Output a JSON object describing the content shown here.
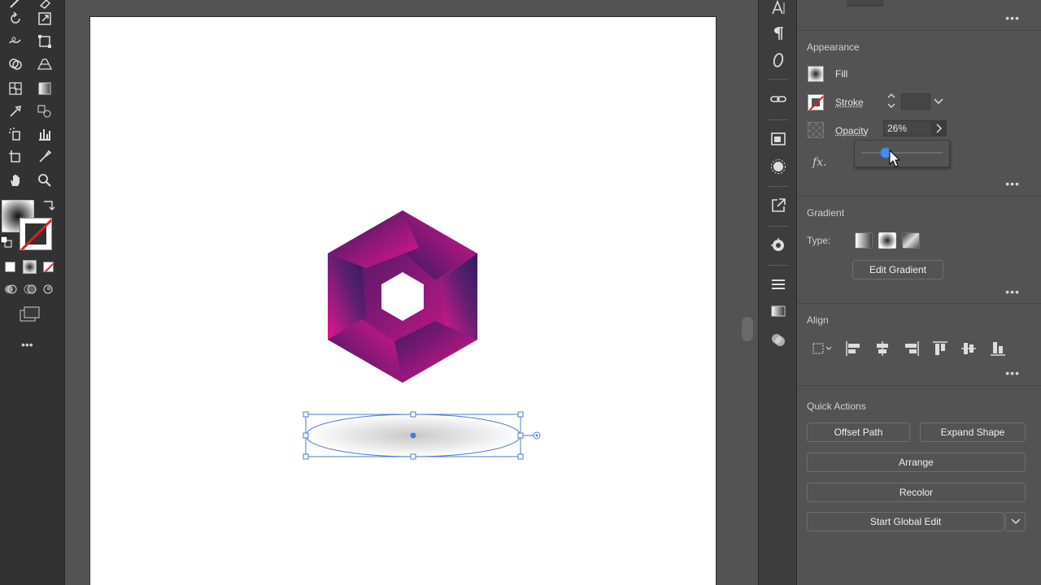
{
  "appearance": {
    "title": "Appearance",
    "fill_label": "Fill",
    "stroke_label": "Stroke",
    "opacity_label": "Opacity",
    "opacity_value": "26%",
    "opacity_fraction": 0.26,
    "fx_label": "fx.",
    "more": "•••"
  },
  "gradient": {
    "title": "Gradient",
    "type_label": "Type:",
    "edit_button": "Edit Gradient",
    "more": "•••"
  },
  "align": {
    "title": "Align",
    "more": "•••"
  },
  "quick_actions": {
    "title": "Quick Actions",
    "offset_path": "Offset Path",
    "expand_shape": "Expand Shape",
    "arrange": "Arrange",
    "recolor": "Recolor",
    "start_global_edit": "Start Global Edit"
  },
  "toolbar": {
    "more": "•••"
  },
  "colors": {
    "hex_pink": "#e8168f",
    "hex_navy": "#2b1a5e",
    "selection_blue": "#4a7bd8",
    "panel_bg": "#535353",
    "toolbar_bg": "#323232"
  }
}
